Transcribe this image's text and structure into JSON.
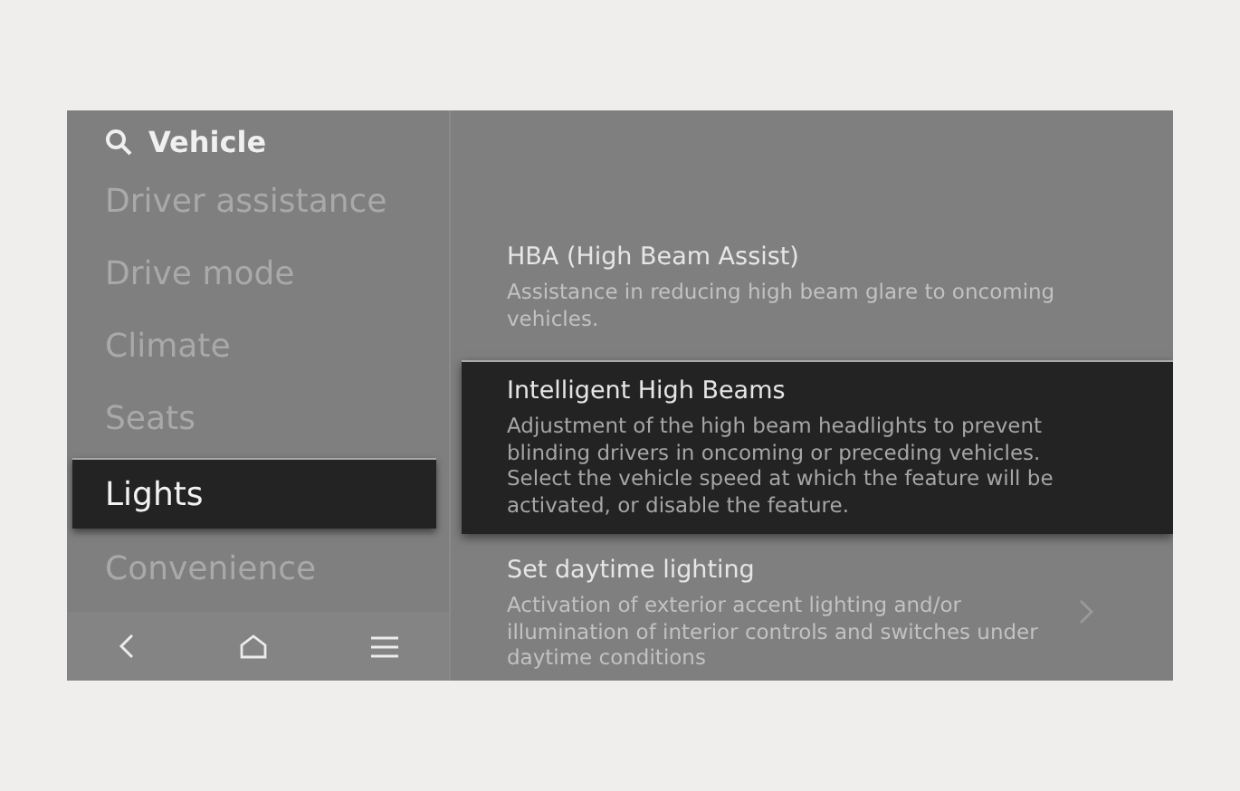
{
  "header": {
    "title": "Vehicle"
  },
  "sidebar": {
    "items": [
      {
        "label": "Driver assistance",
        "selected": false
      },
      {
        "label": "Drive mode",
        "selected": false
      },
      {
        "label": "Climate",
        "selected": false
      },
      {
        "label": "Seats",
        "selected": false
      },
      {
        "label": "Lights",
        "selected": true
      },
      {
        "label": "Convenience",
        "selected": false
      }
    ]
  },
  "settings": [
    {
      "title": "HBA (High Beam Assist)",
      "description": "Assistance in reducing high beam glare to oncoming vehicles.",
      "selected": false,
      "chevron": false
    },
    {
      "title": "Intelligent High Beams",
      "description": "Adjustment of the high beam headlights to prevent blinding drivers in oncoming or preceding vehicles. Select the vehicle speed at which the feature will be activated, or disable the feature.",
      "selected": true,
      "chevron": false
    },
    {
      "title": "Set daytime lighting",
      "description": "Activation of exterior accent lighting and/or illumination of interior controls and switches under daytime conditions",
      "selected": false,
      "chevron": true
    }
  ]
}
